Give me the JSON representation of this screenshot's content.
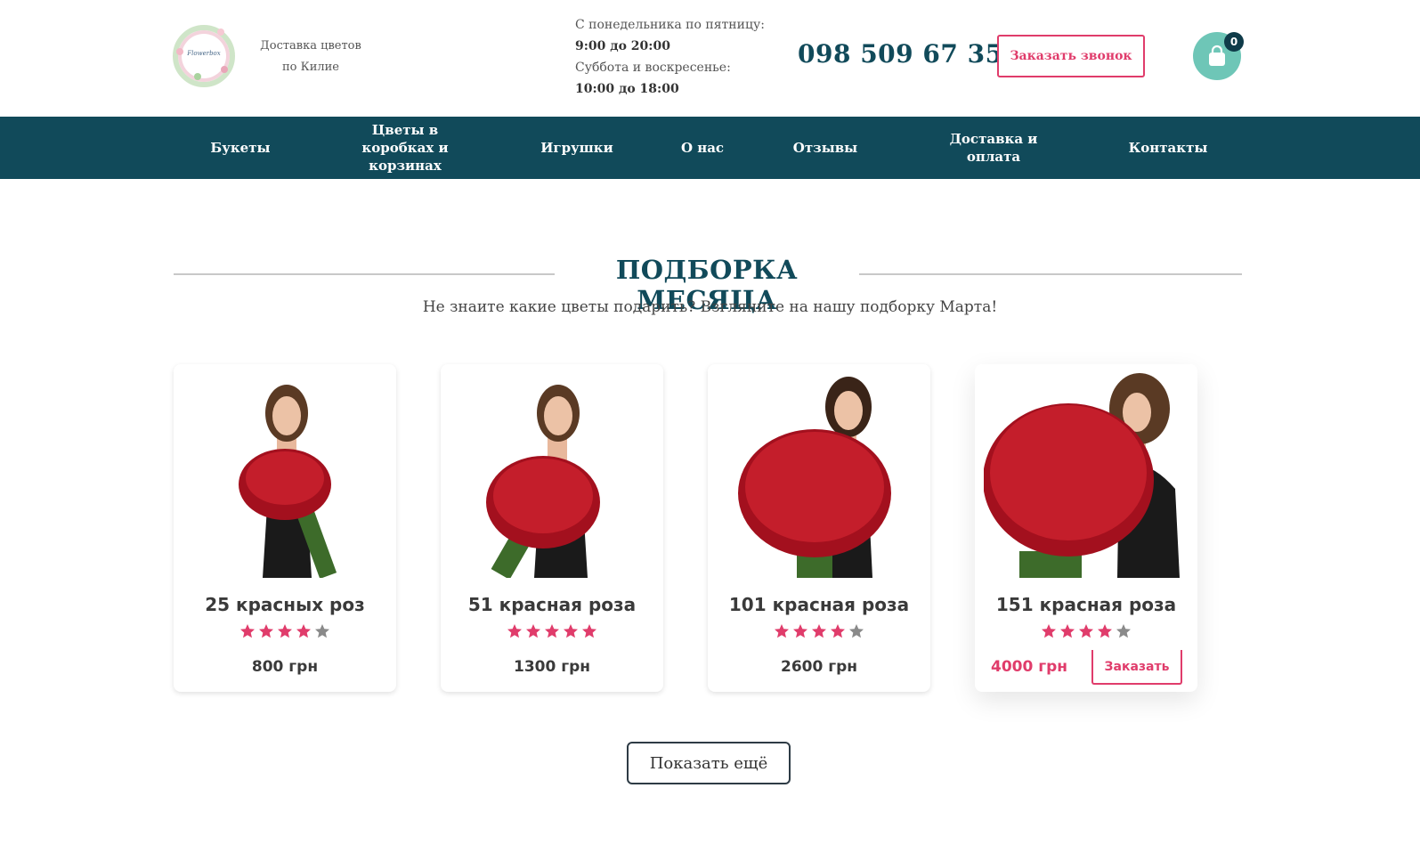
{
  "header": {
    "logo_text": "Flowerbox",
    "tagline": "Доставка цветов по Килие",
    "hours": {
      "weekdays_label": "С понедельника по пятницу:",
      "weekdays_time": "9:00 до 20:00",
      "weekend_label": "Суббота и воскресенье:",
      "weekend_time": "10:00 до 18:00"
    },
    "phone": "098 509 67 35",
    "callback_label": "Заказать звонок",
    "cart_count": "0"
  },
  "nav": {
    "items": [
      {
        "label": "Букеты"
      },
      {
        "label": "Цветы в коробках и корзинах"
      },
      {
        "label": "Игрушки"
      },
      {
        "label": "О нас"
      },
      {
        "label": "Отзывы"
      },
      {
        "label": "Доставка и оплата"
      },
      {
        "label": "Контакты"
      }
    ]
  },
  "section": {
    "title": "ПОДБОРКА МЕСЯЦА",
    "subtitle": "Не знаите какие цветы подарить? Взгляните на нашу подборку Марта!"
  },
  "products": [
    {
      "title": "25 красных роз",
      "rating": 4,
      "price": "800 грн"
    },
    {
      "title": "51 красная роза",
      "rating": 5,
      "price": "1300 грн"
    },
    {
      "title": "101 красная роза",
      "rating": 4,
      "price": "2600 грн"
    },
    {
      "title": "151 красная роза",
      "rating": 4,
      "price": "4000 грн",
      "order_label": "Заказать"
    }
  ],
  "more_label": "Показать ещё",
  "colors": {
    "primary": "#114a5a",
    "accent": "#e03c6b",
    "cart": "#6ec6b7",
    "star_off": "#8a8a8a"
  }
}
